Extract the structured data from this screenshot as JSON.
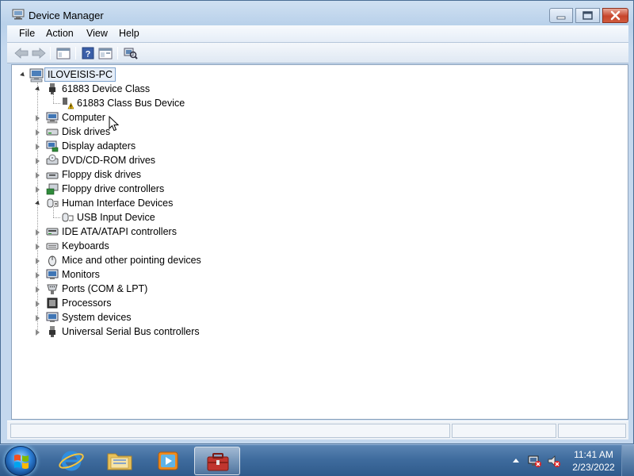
{
  "window": {
    "title": "Device Manager"
  },
  "menu": [
    "File",
    "Action",
    "View",
    "Help"
  ],
  "toolbar": {
    "buttons": [
      "back-arrow-icon",
      "forward-arrow-icon",
      "show-hide-console-tree-icon",
      "help-icon",
      "properties-icon",
      "scan-hardware-icon"
    ]
  },
  "tree": {
    "root": "ILOVEISIS-PC",
    "nodes": [
      {
        "label": "61883 Device Class",
        "expanded": true,
        "icon": "device-class-icon"
      },
      {
        "label": "61883 Class Bus Device",
        "child": true,
        "icon": "warning-device-icon"
      },
      {
        "label": "Computer",
        "icon": "computer-icon"
      },
      {
        "label": "Disk drives",
        "icon": "disk-drive-icon"
      },
      {
        "label": "Display adapters",
        "icon": "display-adapter-icon"
      },
      {
        "label": "DVD/CD-ROM drives",
        "icon": "dvd-drive-icon"
      },
      {
        "label": "Floppy disk drives",
        "icon": "floppy-drive-icon"
      },
      {
        "label": "Floppy drive controllers",
        "icon": "floppy-controller-icon"
      },
      {
        "label": "Human Interface Devices",
        "expanded": true,
        "icon": "hid-icon"
      },
      {
        "label": "USB Input Device",
        "child": true,
        "icon": "hid-device-icon"
      },
      {
        "label": "IDE ATA/ATAPI controllers",
        "icon": "ide-controller-icon"
      },
      {
        "label": "Keyboards",
        "icon": "keyboard-icon"
      },
      {
        "label": "Mice and other pointing devices",
        "icon": "mouse-icon"
      },
      {
        "label": "Monitors",
        "icon": "monitor-icon"
      },
      {
        "label": "Ports (COM & LPT)",
        "icon": "port-icon"
      },
      {
        "label": "Processors",
        "icon": "processor-icon"
      },
      {
        "label": "System devices",
        "icon": "system-device-icon"
      },
      {
        "label": "Universal Serial Bus controllers",
        "icon": "usb-controller-icon"
      }
    ]
  },
  "taskbar": {
    "pinned": [
      "internet-explorer-icon",
      "windows-explorer-icon",
      "media-player-icon",
      "device-manager-task-icon"
    ],
    "clock_time": "11:41 AM",
    "clock_date": "2/23/2022"
  },
  "colors": {
    "window_frame": "#c4d8ee",
    "taskbar": "#3f6c9e",
    "selection_border": "#7da2ce"
  }
}
